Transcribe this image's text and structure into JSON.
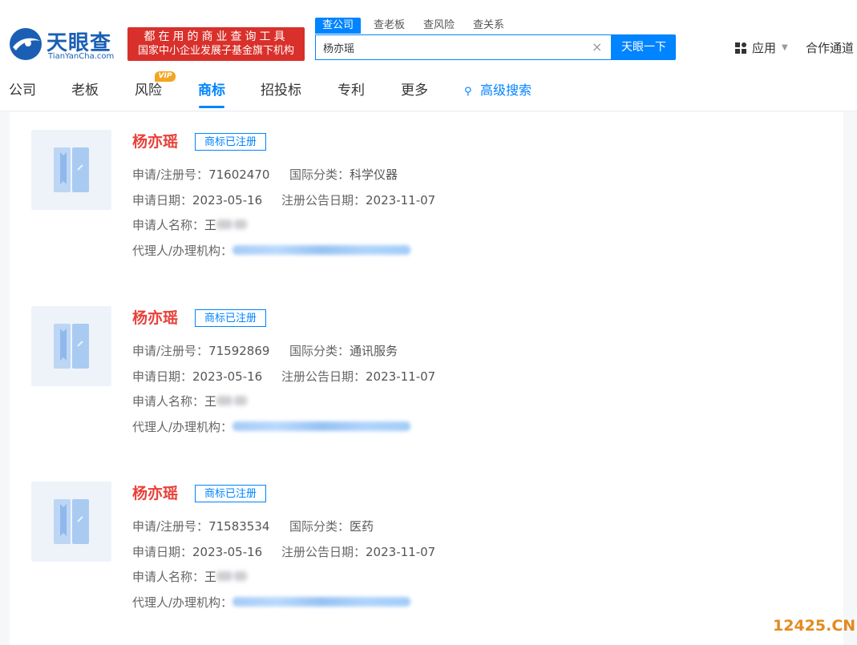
{
  "brand": {
    "name": "天眼查",
    "domain": "TianYanCha.com",
    "banner_line1": "都在用的商业查询工具",
    "banner_line2": "国家中小企业发展子基金旗下机构"
  },
  "search": {
    "tabs": [
      "查公司",
      "查老板",
      "查风险",
      "查关系"
    ],
    "active_tab": "查公司",
    "query": "杨亦瑶",
    "clear_glyph": "×",
    "button_label": "天眼一下"
  },
  "header_right": {
    "apps_label": "应用",
    "apps_caret": "▼",
    "partner_label": "合作通道"
  },
  "nav": {
    "items": [
      "公司",
      "老板",
      "风险",
      "商标",
      "招投标",
      "专利",
      "更多"
    ],
    "active": "商标",
    "vip_badge": "VIP",
    "advanced_search": "高级搜索",
    "accent_color": "#0084ff"
  },
  "labels": {
    "reg_no": "申请/注册号：",
    "intl_class": "国际分类：",
    "apply_date": "申请日期：",
    "publish_date": "注册公告日期：",
    "applicant": "申请人名称：",
    "agent": "代理人/办理机构："
  },
  "trademarks": [
    {
      "name": "杨亦瑶",
      "status": "商标已注册",
      "reg_no": "71602470",
      "intl_class": "科学仪器",
      "apply_date": "2023-05-16",
      "publish_date": "2023-11-07",
      "applicant_visible": "王"
    },
    {
      "name": "杨亦瑶",
      "status": "商标已注册",
      "reg_no": "71592869",
      "intl_class": "通讯服务",
      "apply_date": "2023-05-16",
      "publish_date": "2023-11-07",
      "applicant_visible": "王"
    },
    {
      "name": "杨亦瑶",
      "status": "商标已注册",
      "reg_no": "71583534",
      "intl_class": "医药",
      "apply_date": "2023-05-16",
      "publish_date": "2023-11-07",
      "applicant_visible": "王"
    }
  ],
  "watermark": "12425.CN",
  "colors": {
    "trademark_name": "#e8413a",
    "banner_bg": "#d9302b",
    "vip": "#f4a521",
    "watermark": "#e48a1e"
  }
}
